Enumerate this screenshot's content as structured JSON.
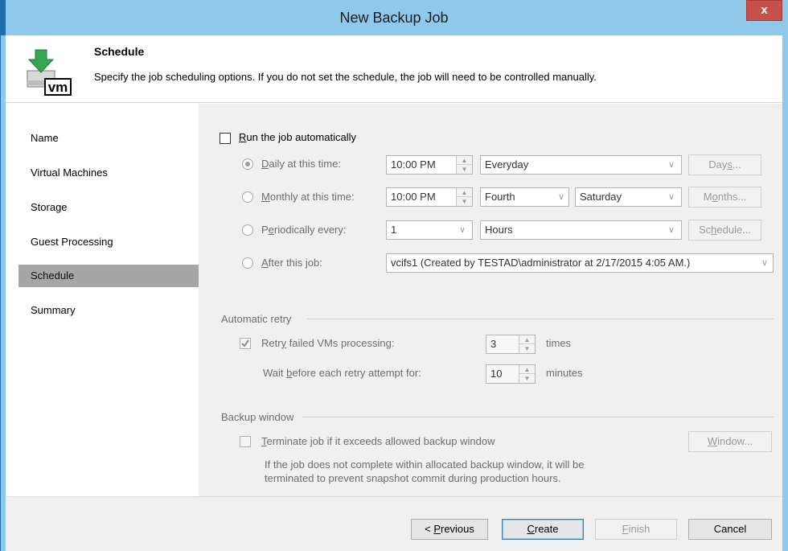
{
  "window": {
    "title": "New Backup Job",
    "close_label": "x"
  },
  "header": {
    "title": "Schedule",
    "description": "Specify the job scheduling options. If you do not set the schedule, the job will need to be controlled manually.",
    "icon_text": "vm"
  },
  "nav": {
    "items": [
      {
        "label": "Name"
      },
      {
        "label": "Virtual Machines"
      },
      {
        "label": "Storage"
      },
      {
        "label": "Guest Processing"
      },
      {
        "label": "Schedule"
      },
      {
        "label": "Summary"
      }
    ],
    "active": "Schedule"
  },
  "schedule": {
    "run_auto": {
      "label_u": "R",
      "label_rest": "un the job automatically",
      "checked": false
    },
    "daily": {
      "label_u": "D",
      "label_rest": "aily at this time:",
      "time": "10:00 PM",
      "frequency": "Everyday",
      "button_u": "s",
      "button_pre": "Day",
      "button_post": "...",
      "selected": true
    },
    "monthly": {
      "label_u": "M",
      "label_rest": "onthly at this time:",
      "time": "10:00 PM",
      "week": "Fourth",
      "day": "Saturday",
      "button_pre": "M",
      "button_u": "o",
      "button_post": "nths...",
      "selected": false
    },
    "periodic": {
      "label_pre": "P",
      "label_u": "e",
      "label_rest": "riodically every:",
      "value": "1",
      "unit": "Hours",
      "button_pre": "Sc",
      "button_u": "h",
      "button_post": "edule...",
      "selected": false
    },
    "after": {
      "label_u": "A",
      "label_rest": "fter this job:",
      "job": "vcifs1 (Created by TESTAD\\administrator at 2/17/2015 4:05 AM.)",
      "selected": false
    }
  },
  "retry": {
    "section_title": "Automatic retry",
    "retry_label_pre": "Retr",
    "retry_label_u": "y",
    "retry_label_rest": " failed VMs processing:",
    "retry_count": "3",
    "retry_unit": "times",
    "retry_checked": true,
    "wait_label_pre": "Wait ",
    "wait_label_u": "b",
    "wait_label_rest": "efore each retry attempt for:",
    "wait_value": "10",
    "wait_unit": "minutes"
  },
  "backup_window": {
    "section_title": "Backup window",
    "terminate_u": "T",
    "terminate_rest": "erminate job if it exceeds allowed backup window",
    "terminate_checked": false,
    "note_line1": "If the job does not complete within allocated backup window, it will be",
    "note_line2": "terminated to prevent snapshot commit during production hours.",
    "window_button_u": "W",
    "window_button_rest": "indow..."
  },
  "footer": {
    "previous_pre": "< ",
    "previous_u": "P",
    "previous_rest": "revious",
    "create_u": "C",
    "create_rest": "reate",
    "finish_u": "F",
    "finish_rest": "inish",
    "cancel": "Cancel"
  },
  "colors": {
    "accent_frame": "#8ec9ec",
    "close": "#c7504b",
    "nav_active": "#a6a6a6"
  }
}
